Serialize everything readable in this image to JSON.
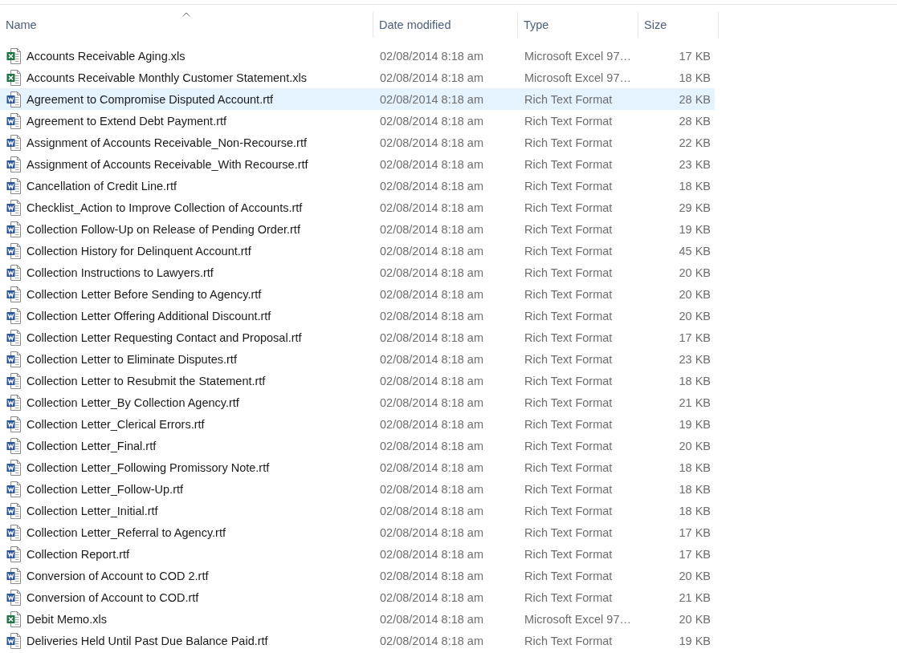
{
  "columns": [
    {
      "label": "Name",
      "sorted": true
    },
    {
      "label": "Date modified",
      "sorted": false
    },
    {
      "label": "Type",
      "sorted": false
    },
    {
      "label": "Size",
      "sorted": false
    }
  ],
  "rows": [
    {
      "kind": "spreadsheet",
      "name": "Accounts Receivable Aging.xls",
      "date": "02/08/2014 8:18 am",
      "type": "Microsoft Excel 97…",
      "size": "17 KB",
      "selected": false
    },
    {
      "kind": "spreadsheet",
      "name": "Accounts Receivable Monthly Customer Statement.xls",
      "date": "02/08/2014 8:18 am",
      "type": "Microsoft Excel 97…",
      "size": "18 KB",
      "selected": false
    },
    {
      "kind": "document",
      "name": "Agreement to Compromise Disputed Account.rtf",
      "date": "02/08/2014 8:18 am",
      "type": "Rich Text Format",
      "size": "28 KB",
      "selected": true
    },
    {
      "kind": "document",
      "name": "Agreement to Extend Debt Payment.rtf",
      "date": "02/08/2014 8:18 am",
      "type": "Rich Text Format",
      "size": "28 KB",
      "selected": false
    },
    {
      "kind": "document",
      "name": "Assignment of Accounts Receivable_Non-Recourse.rtf",
      "date": "02/08/2014 8:18 am",
      "type": "Rich Text Format",
      "size": "22 KB",
      "selected": false
    },
    {
      "kind": "document",
      "name": "Assignment of Accounts Receivable_With Recourse.rtf",
      "date": "02/08/2014 8:18 am",
      "type": "Rich Text Format",
      "size": "23 KB",
      "selected": false
    },
    {
      "kind": "document",
      "name": "Cancellation of Credit Line.rtf",
      "date": "02/08/2014 8:18 am",
      "type": "Rich Text Format",
      "size": "18 KB",
      "selected": false
    },
    {
      "kind": "document",
      "name": "Checklist_Action to Improve Collection of Accounts.rtf",
      "date": "02/08/2014 8:18 am",
      "type": "Rich Text Format",
      "size": "29 KB",
      "selected": false
    },
    {
      "kind": "document",
      "name": "Collection Follow-Up on Release of Pending Order.rtf",
      "date": "02/08/2014 8:18 am",
      "type": "Rich Text Format",
      "size": "19 KB",
      "selected": false
    },
    {
      "kind": "document",
      "name": "Collection History for Delinquent Account.rtf",
      "date": "02/08/2014 8:18 am",
      "type": "Rich Text Format",
      "size": "45 KB",
      "selected": false
    },
    {
      "kind": "document",
      "name": "Collection Instructions to Lawyers.rtf",
      "date": "02/08/2014 8:18 am",
      "type": "Rich Text Format",
      "size": "20 KB",
      "selected": false
    },
    {
      "kind": "document",
      "name": "Collection Letter Before Sending to Agency.rtf",
      "date": "02/08/2014 8:18 am",
      "type": "Rich Text Format",
      "size": "20 KB",
      "selected": false
    },
    {
      "kind": "document",
      "name": "Collection Letter Offering Additional Discount.rtf",
      "date": "02/08/2014 8:18 am",
      "type": "Rich Text Format",
      "size": "20 KB",
      "selected": false
    },
    {
      "kind": "document",
      "name": "Collection Letter Requesting Contact and Proposal.rtf",
      "date": "02/08/2014 8:18 am",
      "type": "Rich Text Format",
      "size": "17 KB",
      "selected": false
    },
    {
      "kind": "document",
      "name": "Collection Letter to Eliminate Disputes.rtf",
      "date": "02/08/2014 8:18 am",
      "type": "Rich Text Format",
      "size": "23 KB",
      "selected": false
    },
    {
      "kind": "document",
      "name": "Collection Letter to Resubmit the Statement.rtf",
      "date": "02/08/2014 8:18 am",
      "type": "Rich Text Format",
      "size": "18 KB",
      "selected": false
    },
    {
      "kind": "document",
      "name": "Collection Letter_By Collection Agency.rtf",
      "date": "02/08/2014 8:18 am",
      "type": "Rich Text Format",
      "size": "21 KB",
      "selected": false
    },
    {
      "kind": "document",
      "name": "Collection Letter_Clerical Errors.rtf",
      "date": "02/08/2014 8:18 am",
      "type": "Rich Text Format",
      "size": "19 KB",
      "selected": false
    },
    {
      "kind": "document",
      "name": "Collection Letter_Final.rtf",
      "date": "02/08/2014 8:18 am",
      "type": "Rich Text Format",
      "size": "20 KB",
      "selected": false
    },
    {
      "kind": "document",
      "name": "Collection Letter_Following Promissory Note.rtf",
      "date": "02/08/2014 8:18 am",
      "type": "Rich Text Format",
      "size": "18 KB",
      "selected": false
    },
    {
      "kind": "document",
      "name": "Collection Letter_Follow-Up.rtf",
      "date": "02/08/2014 8:18 am",
      "type": "Rich Text Format",
      "size": "18 KB",
      "selected": false
    },
    {
      "kind": "document",
      "name": "Collection Letter_Initial.rtf",
      "date": "02/08/2014 8:18 am",
      "type": "Rich Text Format",
      "size": "18 KB",
      "selected": false
    },
    {
      "kind": "document",
      "name": "Collection Letter_Referral to Agency.rtf",
      "date": "02/08/2014 8:18 am",
      "type": "Rich Text Format",
      "size": "17 KB",
      "selected": false
    },
    {
      "kind": "document",
      "name": "Collection Report.rtf",
      "date": "02/08/2014 8:18 am",
      "type": "Rich Text Format",
      "size": "17 KB",
      "selected": false
    },
    {
      "kind": "document",
      "name": "Conversion of Account to COD 2.rtf",
      "date": "02/08/2014 8:18 am",
      "type": "Rich Text Format",
      "size": "20 KB",
      "selected": false
    },
    {
      "kind": "document",
      "name": "Conversion of Account to COD.rtf",
      "date": "02/08/2014 8:18 am",
      "type": "Rich Text Format",
      "size": "21 KB",
      "selected": false
    },
    {
      "kind": "spreadsheet",
      "name": "Debit Memo.xls",
      "date": "02/08/2014 8:18 am",
      "type": "Microsoft Excel 97…",
      "size": "20 KB",
      "selected": false
    },
    {
      "kind": "document",
      "name": "Deliveries Held Until Past Due Balance Paid.rtf",
      "date": "02/08/2014 8:18 am",
      "type": "Rich Text Format",
      "size": "19 KB",
      "selected": false
    }
  ]
}
